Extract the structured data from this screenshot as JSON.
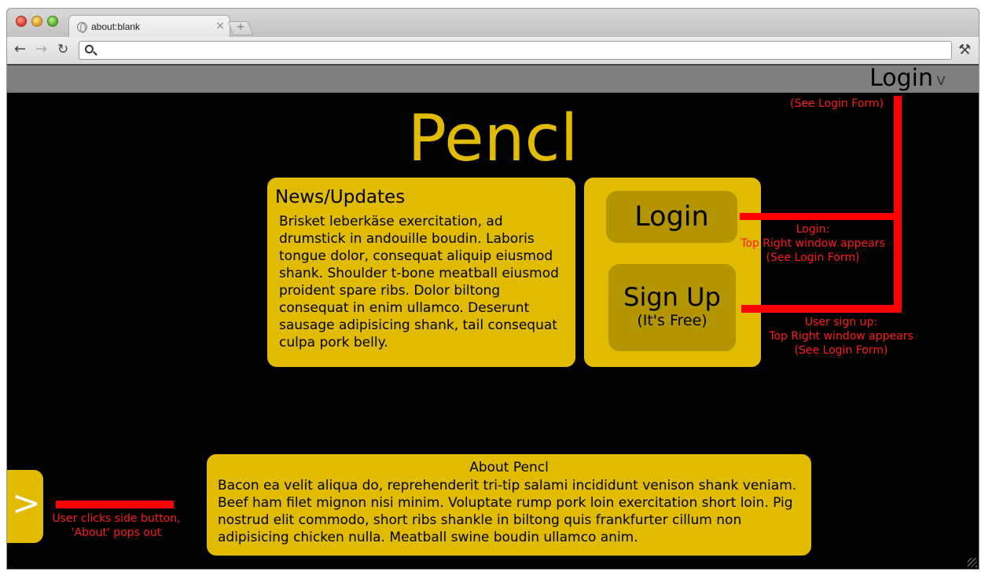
{
  "browser": {
    "tab_title": "about:blank",
    "tab_close": "×",
    "new_tab": "+",
    "address_value": "",
    "icons": {
      "back": "←",
      "forward": "→",
      "reload": "C",
      "wrench": "🔧"
    }
  },
  "header": {
    "login_label": "Login",
    "login_caret": "v"
  },
  "logo": "Pencl",
  "news": {
    "title": "News/Updates",
    "body": "Brisket leberkäse exercitation, ad drumstick in andouille boudin. Laboris tongue dolor, consequat aliquip eiusmod shank. Shoulder t-bone meatball eiusmod proident spare ribs. Dolor biltong consequat in enim ullamco. Deserunt sausage adipisicing shank, tail consequat culpa pork belly."
  },
  "auth": {
    "login_label": "Login",
    "signup_label": "Sign Up",
    "signup_sub": "(It's Free)"
  },
  "side_button": {
    "label": ">"
  },
  "about": {
    "title": "About Pencl",
    "body": "Bacon ea velit aliqua do, reprehenderit tri-tip salami incididunt venison shank veniam. Beef ham filet mignon nisi minim. Voluptate rump pork loin exercitation short loin. Pig nostrud elit commodo, short ribs shankle in biltong quis frankfurter cillum non adipisicing chicken nulla. Meatball swine boudin ullamco anim."
  },
  "annotations": {
    "top_login": "(See Login Form)",
    "login_1": "Login:",
    "login_2": "Top Right window appears",
    "login_3": "(See Login Form)",
    "signup_1": "User sign up:",
    "signup_2": "Top Right window appears",
    "signup_3": "(See Login Form)",
    "side_1": "User clicks side button,",
    "side_2": "'About' pops out"
  },
  "colors": {
    "accent": "#e0bb00",
    "button": "#b39500",
    "annotation": "#ff0000",
    "topbar": "#7f7f7f"
  }
}
